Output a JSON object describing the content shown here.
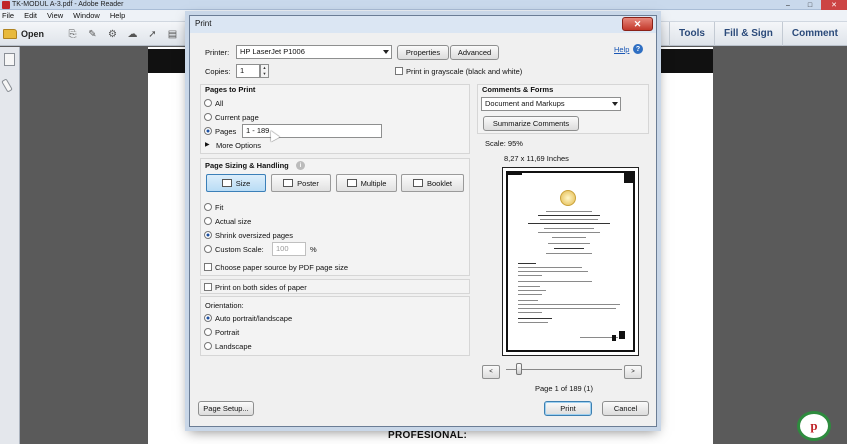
{
  "app": {
    "title": "TK-MODUL A-3.pdf - Adobe Reader",
    "menu": [
      "File",
      "Edit",
      "View",
      "Window",
      "Help"
    ],
    "toolbar": {
      "open_label": "Open",
      "right_tabs": [
        "Tools",
        "Fill & Sign",
        "Comment"
      ]
    },
    "document_heading": "PROFESIONAL:",
    "logo_text": "p",
    "window_buttons": {
      "minimize": "–",
      "maximize": "□",
      "close": "✕"
    }
  },
  "dialog": {
    "title": "Print",
    "close_glyph": "✕",
    "printer_label": "Printer:",
    "printer_value": "HP LaserJet P1006",
    "properties_label": "Properties",
    "advanced_label": "Advanced",
    "help_label": "Help",
    "help_glyph": "?",
    "copies_label": "Copies:",
    "copies_value": "1",
    "grayscale_label": "Print in grayscale (black and white)",
    "pages_to_print": {
      "heading": "Pages to Print",
      "all_label": "All",
      "current_label": "Current page",
      "pages_label": "Pages",
      "pages_value": "1 - 189",
      "more_options_label": "More Options",
      "selected": "pages"
    },
    "sizing": {
      "heading": "Page Sizing & Handling",
      "info_glyph": "i",
      "buttons": [
        "Size",
        "Poster",
        "Multiple",
        "Booklet"
      ],
      "active": "Size",
      "fit_label": "Fit",
      "actual_label": "Actual size",
      "shrink_label": "Shrink oversized pages",
      "custom_label": "Custom Scale:",
      "custom_value": "100",
      "custom_unit": "%",
      "paper_source_label": "Choose paper source by PDF page size",
      "selected": "shrink"
    },
    "both_sides_label": "Print on both sides of paper",
    "orientation": {
      "heading": "Orientation:",
      "auto_label": "Auto portrait/landscape",
      "portrait_label": "Portrait",
      "landscape_label": "Landscape",
      "selected": "auto"
    },
    "comments_forms": {
      "heading": "Comments & Forms",
      "value": "Document and Markups",
      "summarize_label": "Summarize Comments"
    },
    "preview": {
      "scale_text": "Scale: 95%",
      "paper_size_text": "8,27 x 11,69 Inches",
      "page_counter": "Page 1 of 189 (1)",
      "prev_glyph": "<",
      "next_glyph": ">"
    },
    "page_setup_label": "Page Setup...",
    "print_label": "Print",
    "cancel_label": "Cancel"
  }
}
